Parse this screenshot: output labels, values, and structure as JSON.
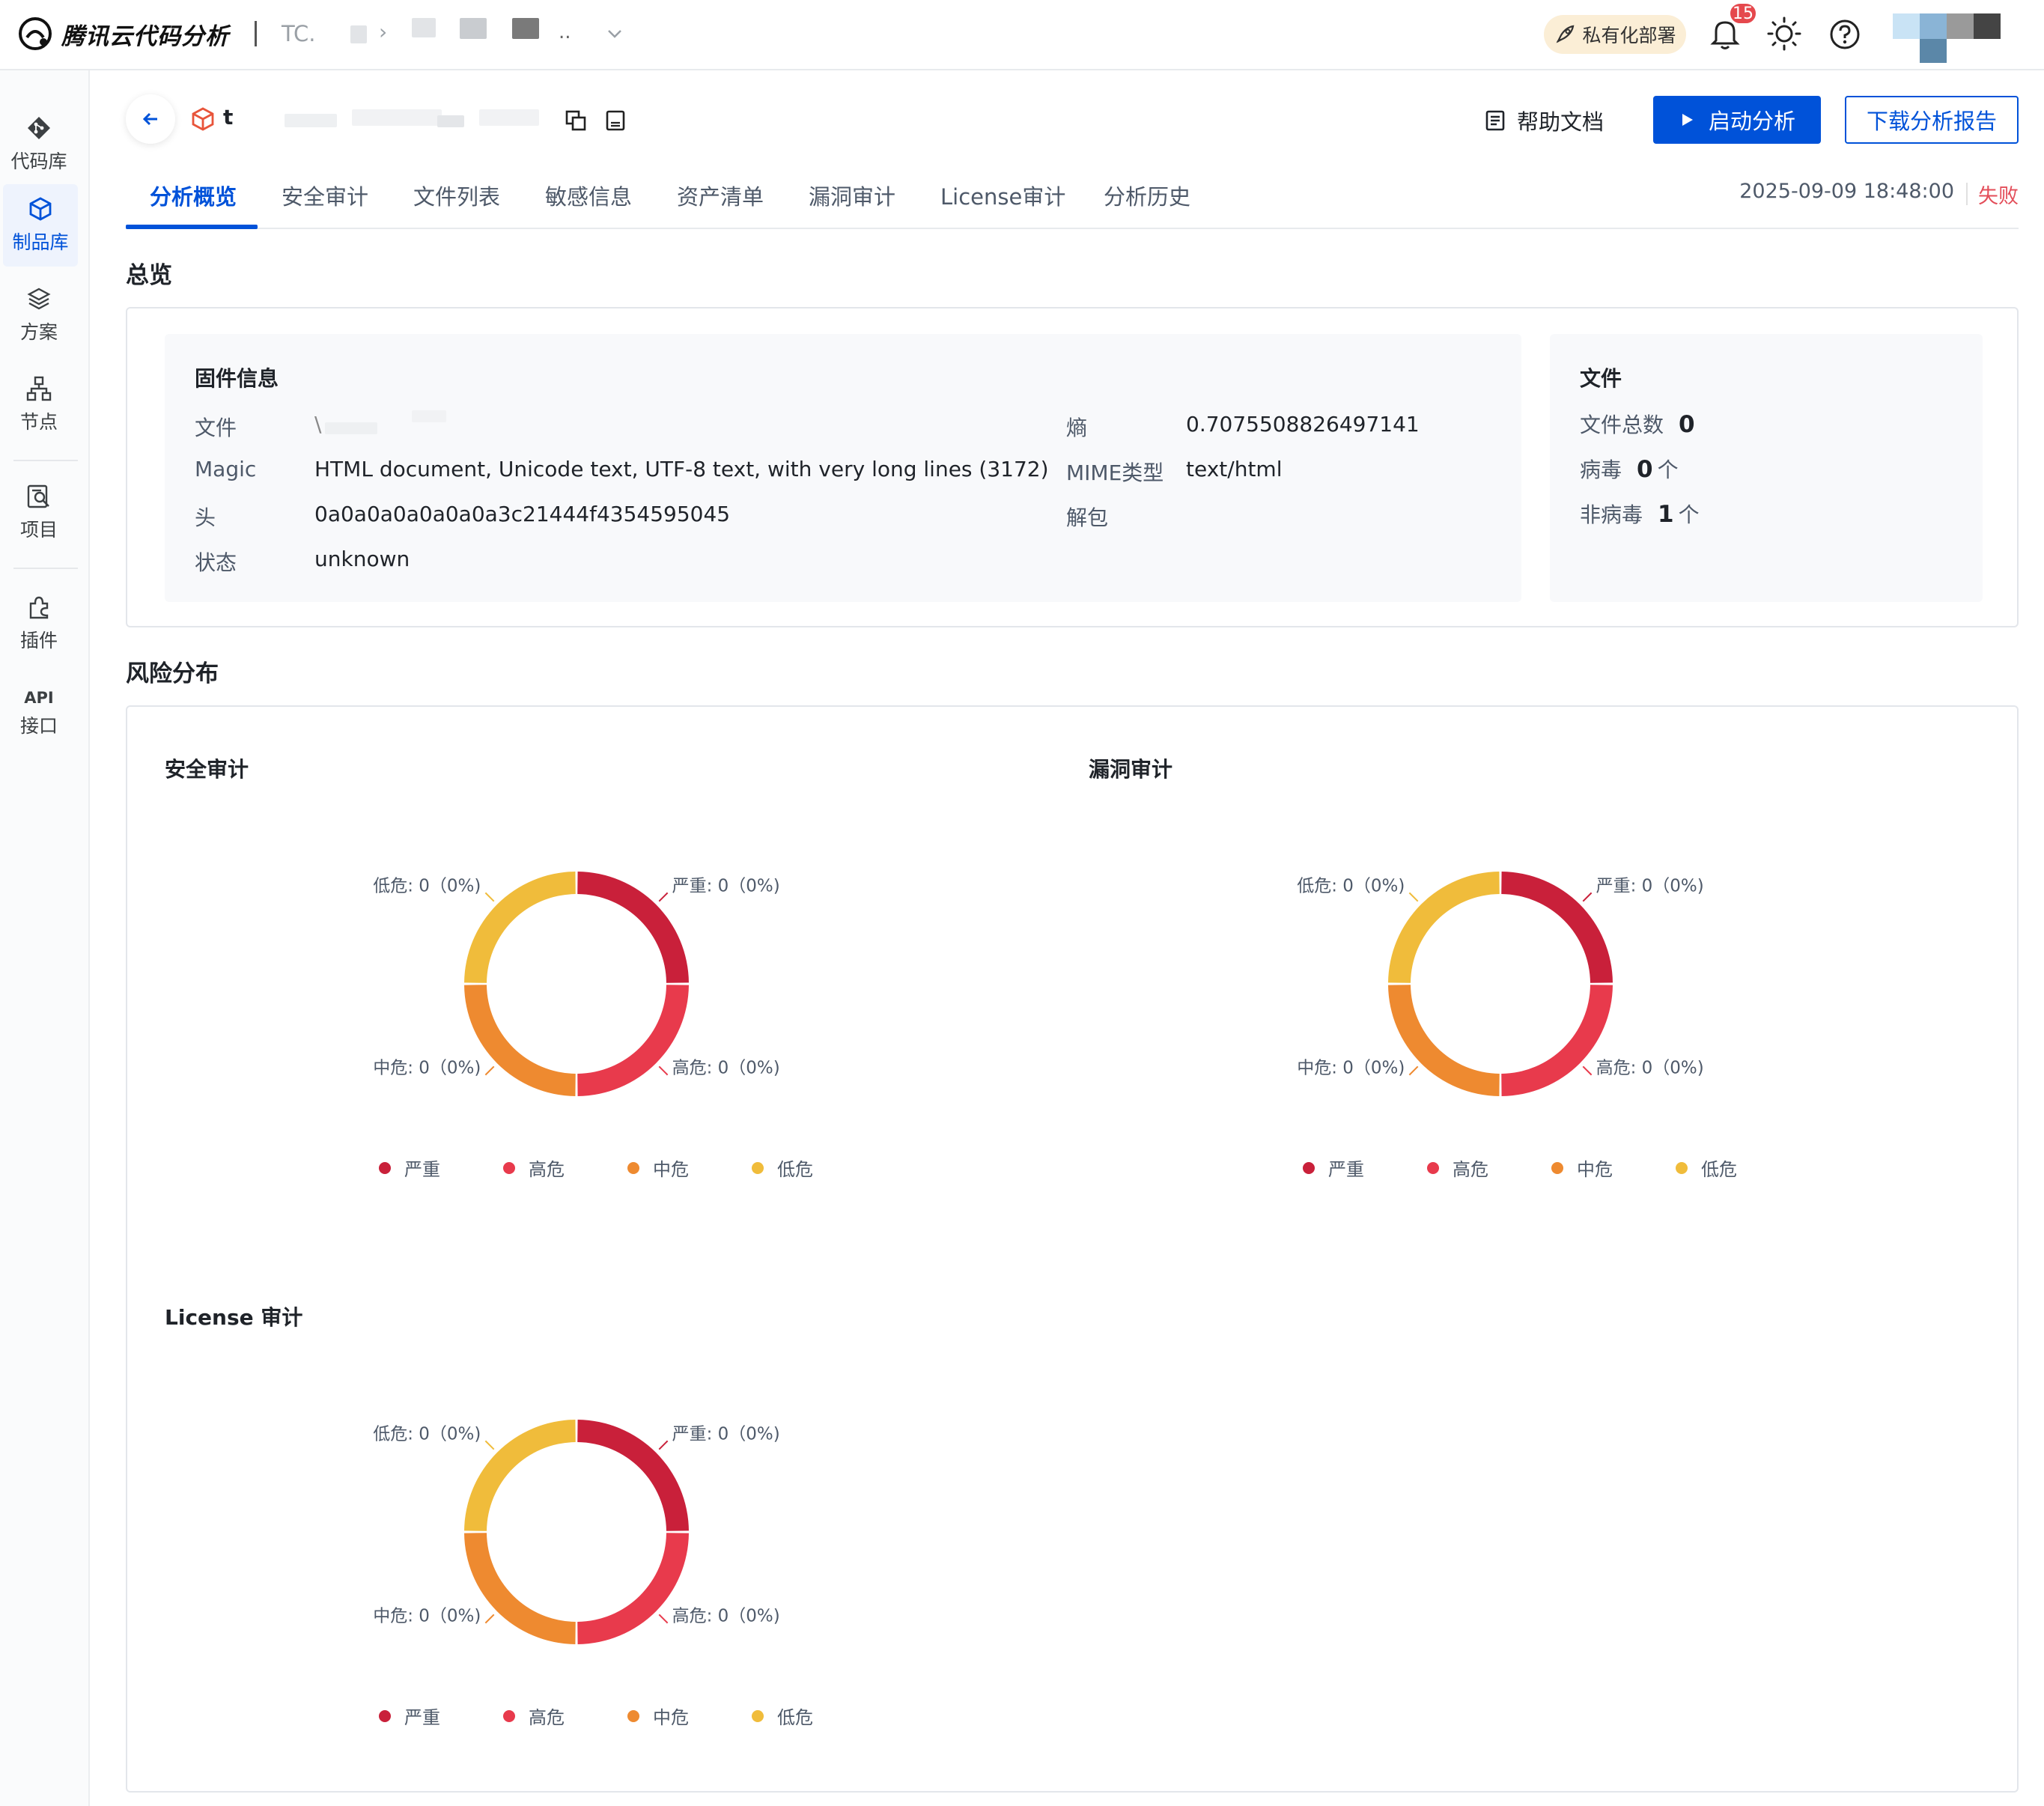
{
  "app": {
    "title": "腾讯云代码分析"
  },
  "breadcrumb": {
    "org": "TC.",
    "chevron": "›",
    "dropdown_dots": ".."
  },
  "header_actions": {
    "deploy_label": "私有化部署",
    "notification_count": "15"
  },
  "sidebar": {
    "items": [
      {
        "label": "代码库",
        "icon": "git-icon",
        "active": false
      },
      {
        "label": "制品库",
        "icon": "cube-icon",
        "active": true
      },
      {
        "label": "方案",
        "icon": "layers-icon",
        "active": false
      },
      {
        "label": "节点",
        "icon": "nodes-icon",
        "active": false
      },
      {
        "label": "项目",
        "icon": "project-search-icon",
        "active": false
      },
      {
        "label": "插件",
        "icon": "plugin-icon",
        "active": false
      },
      {
        "label": "接口",
        "prefix": "API",
        "icon": "api-text",
        "active": false
      }
    ]
  },
  "product": {
    "name": "t",
    "help_doc": "帮助文档",
    "start_btn": "启动分析",
    "download_btn": "下载分析报告"
  },
  "tabs": {
    "items": [
      "分析概览",
      "安全审计",
      "文件列表",
      "敏感信息",
      "资产清单",
      "漏洞审计",
      "License审计",
      "分析历史"
    ],
    "active_index": 0,
    "timestamp": "2025-09-09 18:48:00",
    "status": "失败"
  },
  "overview": {
    "title": "总览",
    "firmware": {
      "title": "固件信息",
      "rows": [
        {
          "label": "文件",
          "value": "\\"
        },
        {
          "label": "Magic",
          "value": "HTML document, Unicode text, UTF-8 text, with very long lines (3172)"
        },
        {
          "label": "头",
          "value": "0a0a0a0a0a0a0a3c21444f4354595045"
        },
        {
          "label": "状态",
          "value": "unknown"
        }
      ],
      "rows_right": [
        {
          "label": "熵",
          "value": "0.7075508826497141"
        },
        {
          "label": "MIME类型",
          "value": "text/html"
        },
        {
          "label": "解包",
          "value": ""
        }
      ]
    },
    "files": {
      "title": "文件",
      "rows": [
        {
          "label": "文件总数",
          "value": "0",
          "unit": ""
        },
        {
          "label": "病毒",
          "value": "0",
          "unit": "个"
        },
        {
          "label": "非病毒",
          "value": "1",
          "unit": "个"
        }
      ]
    }
  },
  "risk": {
    "title": "风险分布",
    "colors": {
      "critical": "#c9203a",
      "high": "#e83a4c",
      "medium": "#ee8a30",
      "low": "#f0bc3b"
    },
    "legend": [
      "严重",
      "高危",
      "中危",
      "低危"
    ]
  },
  "chart_data": [
    {
      "type": "pie",
      "title": "安全审计",
      "categories": [
        "严重",
        "高危",
        "中危",
        "低危"
      ],
      "values": [
        0,
        0,
        0,
        0
      ],
      "labels": [
        "严重: 0（0%)",
        "高危: 0（0%)",
        "中危: 0（0%)",
        "低危: 0（0%)"
      ],
      "legend_position": "bottom"
    },
    {
      "type": "pie",
      "title": "漏洞审计",
      "categories": [
        "严重",
        "高危",
        "中危",
        "低危"
      ],
      "values": [
        0,
        0,
        0,
        0
      ],
      "labels": [
        "严重: 0（0%)",
        "高危: 0（0%)",
        "中危: 0（0%)",
        "低危: 0（0%)"
      ],
      "legend_position": "bottom"
    },
    {
      "type": "pie",
      "title": "License 审计",
      "categories": [
        "严重",
        "高危",
        "中危",
        "低危"
      ],
      "values": [
        0,
        0,
        0,
        0
      ],
      "labels": [
        "严重: 0（0%)",
        "高危: 0（0%)",
        "中危: 0（0%)",
        "低危: 0（0%)"
      ],
      "legend_position": "bottom"
    }
  ]
}
